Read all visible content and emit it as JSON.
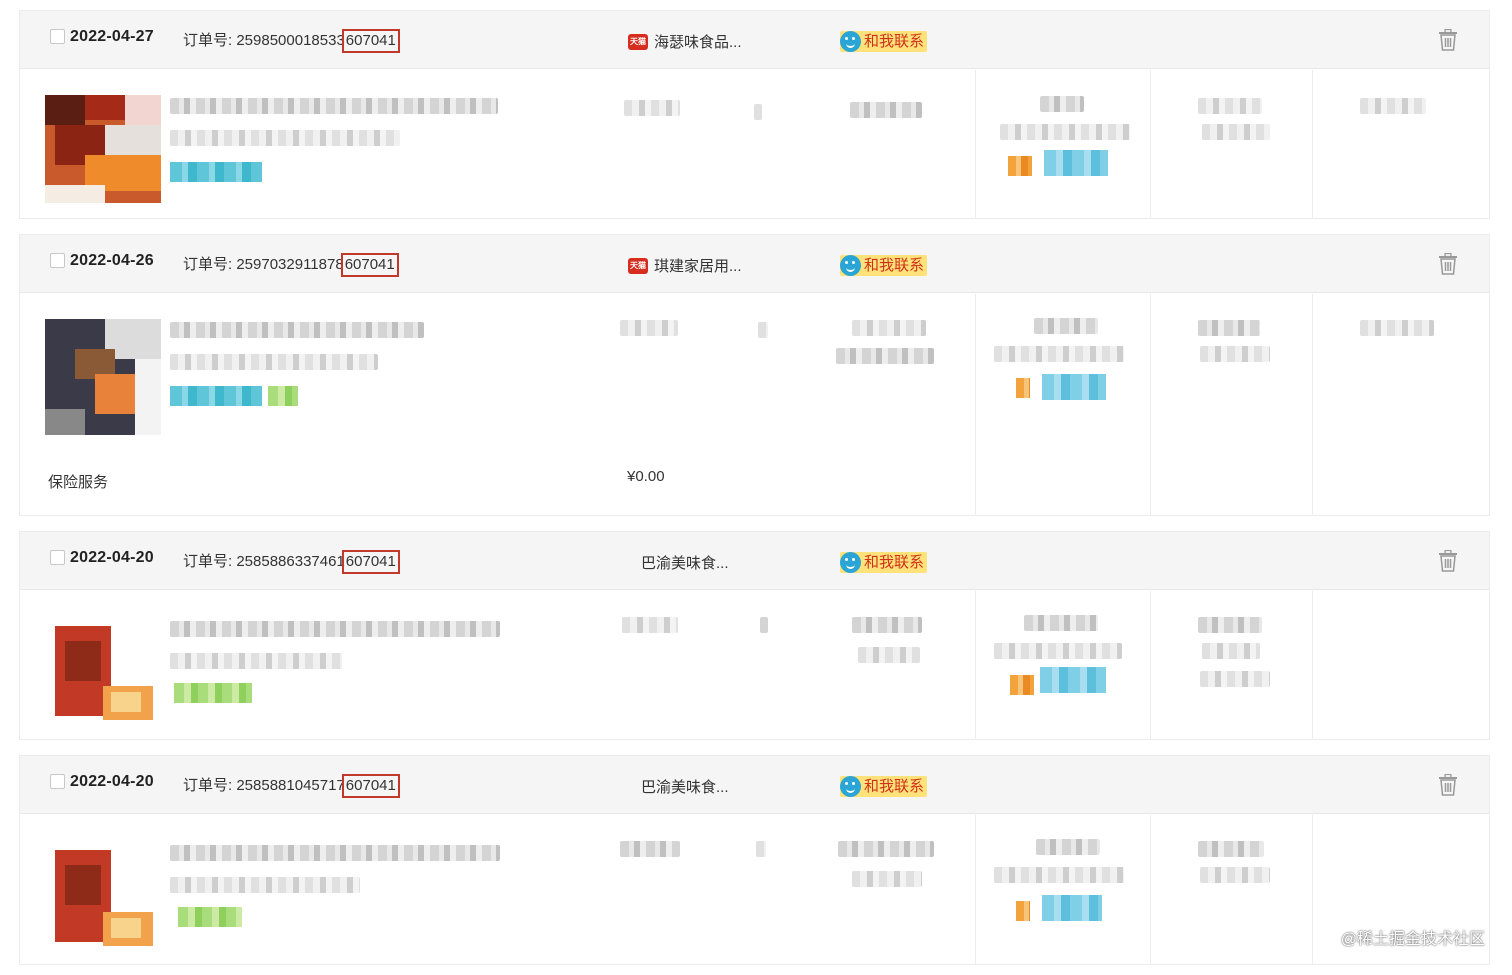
{
  "contact_label": "和我联系",
  "tmall_badge": "天猫",
  "orders": [
    {
      "date": "2022-04-27",
      "order_prefix": "订单号: ",
      "order_no_start": "25985000185",
      "order_no_mid": "33",
      "order_no_highlight": "607041",
      "shop": "海瑟味食品...",
      "shop_icon": "tmall-icon"
    },
    {
      "date": "2022-04-26",
      "order_prefix": "订单号: ",
      "order_no_start": "25970329118",
      "order_no_mid": "78",
      "order_no_highlight": "607041",
      "shop": "琪建家居用...",
      "shop_icon": "tmall-icon",
      "service": {
        "label": "保险服务",
        "price": "¥0.00"
      }
    },
    {
      "date": "2022-04-20",
      "order_prefix": "订单号: ",
      "order_no_start": "25858863374",
      "order_no_mid": "61",
      "order_no_highlight": "607041",
      "shop": "巴渝美味食...",
      "shop_icon": ""
    },
    {
      "date": "2022-04-20",
      "order_prefix": "订单号: ",
      "order_no_start": "25858810457",
      "order_no_mid": "17",
      "order_no_highlight": "607041",
      "shop": "巴渝美味食...",
      "shop_icon": ""
    }
  ],
  "watermark": "@稀土掘金技术社区",
  "colors": {
    "highlight_border": "#c0392b",
    "contact_bg": "#ffe27a",
    "contact_text": "#d0311a",
    "header_bg": "#f5f5f5"
  }
}
